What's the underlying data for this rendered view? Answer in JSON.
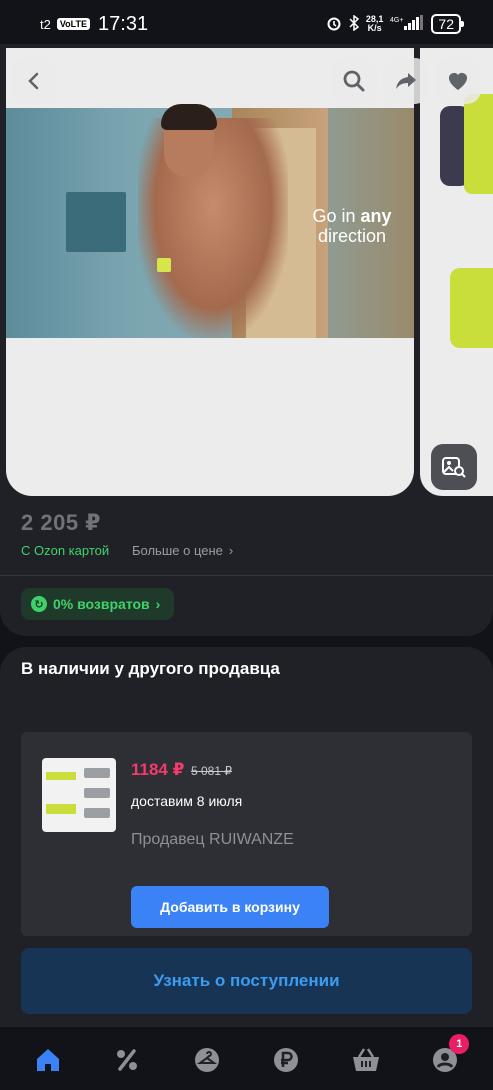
{
  "statusbar": {
    "carrier": "t2",
    "volte": "VoLTE",
    "time": "17:31",
    "speed_value": "28,1",
    "speed_unit": "K/s",
    "battery": "72"
  },
  "gallery": {
    "video_caption_pre": "Go in",
    "video_caption_bold": "any",
    "video_caption_post": "direction"
  },
  "product": {
    "price": "2 205 ₽",
    "ozon_card": "С Ozon картой",
    "more_price": "Больше о цене",
    "returns": "0% возвратов"
  },
  "seller_section": {
    "title": "В наличии у другого продавца",
    "offer": {
      "price": "1184 ₽",
      "old_price": "5 081 ₽",
      "delivery": "доставим 8 июля",
      "seller": "Продавец RUIWANZE",
      "add_to_cart": "Добавить в корзину"
    }
  },
  "notify_button": "Узнать о поступлении",
  "bottom_nav": {
    "items": [
      "home-icon",
      "percent-icon",
      "hanger-icon",
      "ruble-icon",
      "basket-icon",
      "profile-icon"
    ],
    "profile_badge": "1",
    "active_color": "#3b82f6",
    "inactive_color": "#8d9096"
  },
  "colors": {
    "accent_green": "#3fd26a",
    "price_red": "#f23a6b",
    "button_blue": "#3b82f6",
    "notify_text": "#3b9cf2"
  }
}
